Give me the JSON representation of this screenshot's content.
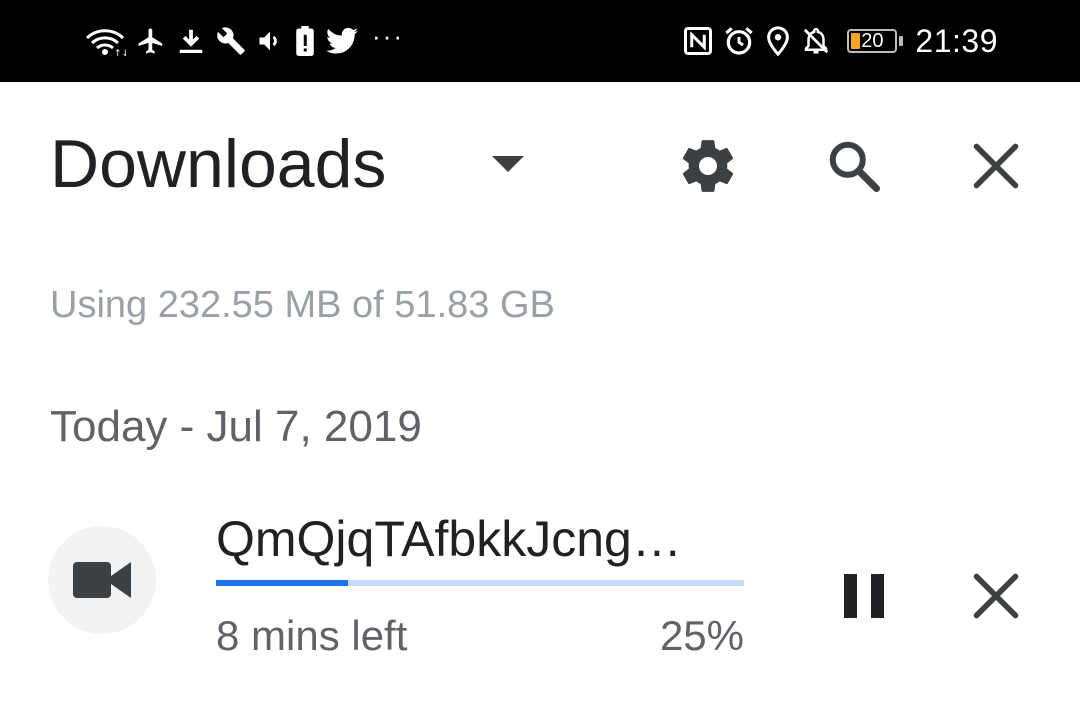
{
  "status_bar": {
    "left_icons": [
      "wifi-icon",
      "airplane-icon",
      "download-icon",
      "wrench-icon",
      "volume-icon",
      "battery-alert-icon",
      "twitter-icon",
      "more-icon"
    ],
    "more_text": "···",
    "right_icons": [
      "nfc-icon",
      "alarm-icon",
      "location-icon",
      "notifications-off-icon"
    ],
    "battery_level": "20",
    "time": "21:39"
  },
  "header": {
    "title": "Downloads",
    "dropdown_icon": "caret-down-icon",
    "settings_icon": "gear-icon",
    "search_icon": "search-icon",
    "close_icon": "close-icon"
  },
  "storage": {
    "text": "Using 232.55 MB of 51.83 GB"
  },
  "section": {
    "date_heading": "Today - Jul 7, 2019"
  },
  "download": {
    "file_name": "QmQjqTAfbkkJcng…",
    "type_icon": "video-camera-icon",
    "progress_fraction": 0.25,
    "time_left": "8 mins left",
    "percent": "25%",
    "pause_icon": "pause-icon",
    "cancel_icon": "close-icon"
  },
  "colors": {
    "status_bar_bg": "#000000",
    "accent": "#1a73e8",
    "progress_track": "#c6dafc",
    "battery_fill": "#f5a623",
    "primary_text": "#202124",
    "secondary_text": "#5f6368"
  }
}
